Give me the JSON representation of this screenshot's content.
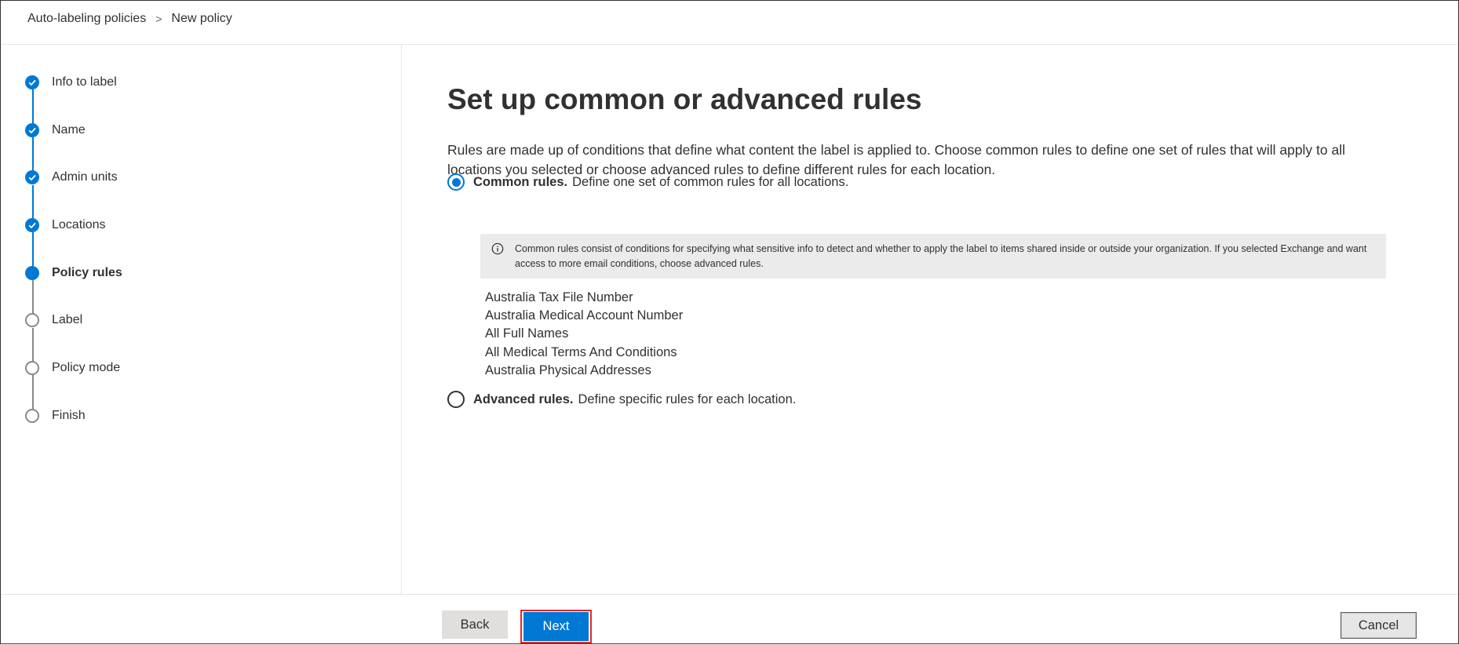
{
  "breadcrumb": {
    "items": [
      "Auto-labeling policies",
      "New policy"
    ],
    "separator": ">"
  },
  "steps": [
    {
      "label": "Info to label",
      "state": "done"
    },
    {
      "label": "Name",
      "state": "done"
    },
    {
      "label": "Admin units",
      "state": "done"
    },
    {
      "label": "Locations",
      "state": "done"
    },
    {
      "label": "Policy rules",
      "state": "current"
    },
    {
      "label": "Label",
      "state": "todo"
    },
    {
      "label": "Policy mode",
      "state": "todo"
    },
    {
      "label": "Finish",
      "state": "todo"
    }
  ],
  "main": {
    "title": "Set up common or advanced rules",
    "description": "Rules are made up of conditions that define what content the label is applied to. Choose common rules to define one set of rules that will apply to all locations you selected or choose advanced rules to define different rules for each location.",
    "options": {
      "common": {
        "title": "Common rules.",
        "text": "Define one set of common rules for all locations.",
        "selected": true
      },
      "advanced": {
        "title": "Advanced rules.",
        "text": "Define specific rules for each location.",
        "selected": false
      }
    },
    "info_text": "Common rules consist of conditions for specifying what sensitive info to detect and whether to apply the label to items shared inside or outside your organization. If you selected Exchange and want access to more email conditions, choose advanced rules.",
    "sensitive_info_types": [
      "Australia Tax File Number",
      "Australia Medical Account Number",
      "All Full Names",
      "All Medical Terms And Conditions",
      "Australia Physical Addresses"
    ]
  },
  "footer": {
    "back_label": "Back",
    "next_label": "Next",
    "cancel_label": "Cancel"
  },
  "colors": {
    "accent": "#0078d4",
    "highlight_outline": "#e0282b"
  }
}
